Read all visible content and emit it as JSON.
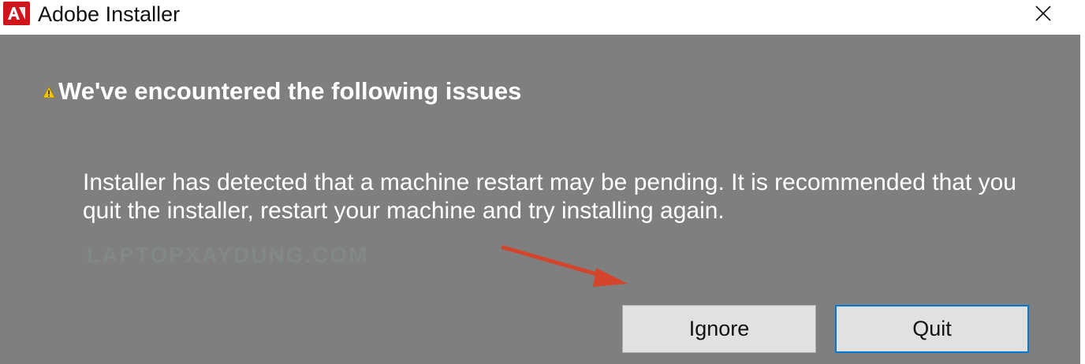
{
  "window": {
    "title": "Adobe Installer",
    "app_icon": "adobe-logo-icon",
    "close_icon": "close-icon"
  },
  "dialog": {
    "warning_icon": "warning-icon",
    "heading": "We've encountered the following issues",
    "message": "Installer has detected that a machine restart may be pending. It is recommended that you quit the installer, restart your machine and try installing again.",
    "watermark": "LAPTOPXAYDUNG.COM"
  },
  "buttons": {
    "ignore_label": "Ignore",
    "quit_label": "Quit"
  },
  "colors": {
    "content_bg": "#7f7f7f",
    "brand_red": "#d0151d",
    "annotation_arrow": "#d3442b",
    "focus_border": "#0078d7"
  }
}
